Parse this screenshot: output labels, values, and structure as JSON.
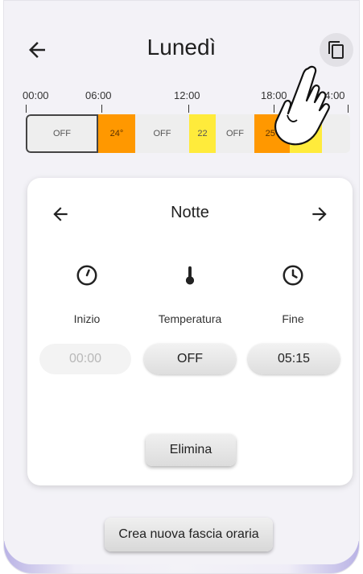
{
  "header": {
    "title": "Lunedì",
    "back_icon": "arrow-left-icon",
    "copy_icon": "copy-icon"
  },
  "timeline": {
    "ticks": [
      "00:00",
      "06:00",
      "12:00",
      "18:00",
      "24:00"
    ],
    "segments": [
      {
        "label": "OFF",
        "color": "#eeeeee",
        "selected": true
      },
      {
        "label": "24°",
        "color": "#ff9800"
      },
      {
        "label": "OFF",
        "color": "#eeeeee"
      },
      {
        "label": "22",
        "color": "#ffeb3b"
      },
      {
        "label": "OFF",
        "color": "#eeeeee"
      },
      {
        "label": "25°",
        "color": "#ff9800"
      },
      {
        "label": "2",
        "color": "#ffeb3b"
      },
      {
        "label": "",
        "color": "#eeeeee"
      }
    ]
  },
  "card": {
    "title": "Notte",
    "prev_icon": "arrow-left-icon",
    "next_icon": "arrow-right-icon",
    "columns": {
      "start": {
        "icon": "clock-start-icon",
        "label": "Inizio",
        "value": "00:00"
      },
      "temperature": {
        "icon": "thermometer-icon",
        "label": "Temperatura",
        "value": "OFF"
      },
      "end": {
        "icon": "clock-icon",
        "label": "Fine",
        "value": "05:15"
      }
    },
    "delete_label": "Elimina"
  },
  "create_label": "Crea nuova fascia oraria",
  "colors": {
    "accent_orange": "#ff9800",
    "accent_yellow": "#ffeb3b",
    "background": "#f3f2f7"
  }
}
